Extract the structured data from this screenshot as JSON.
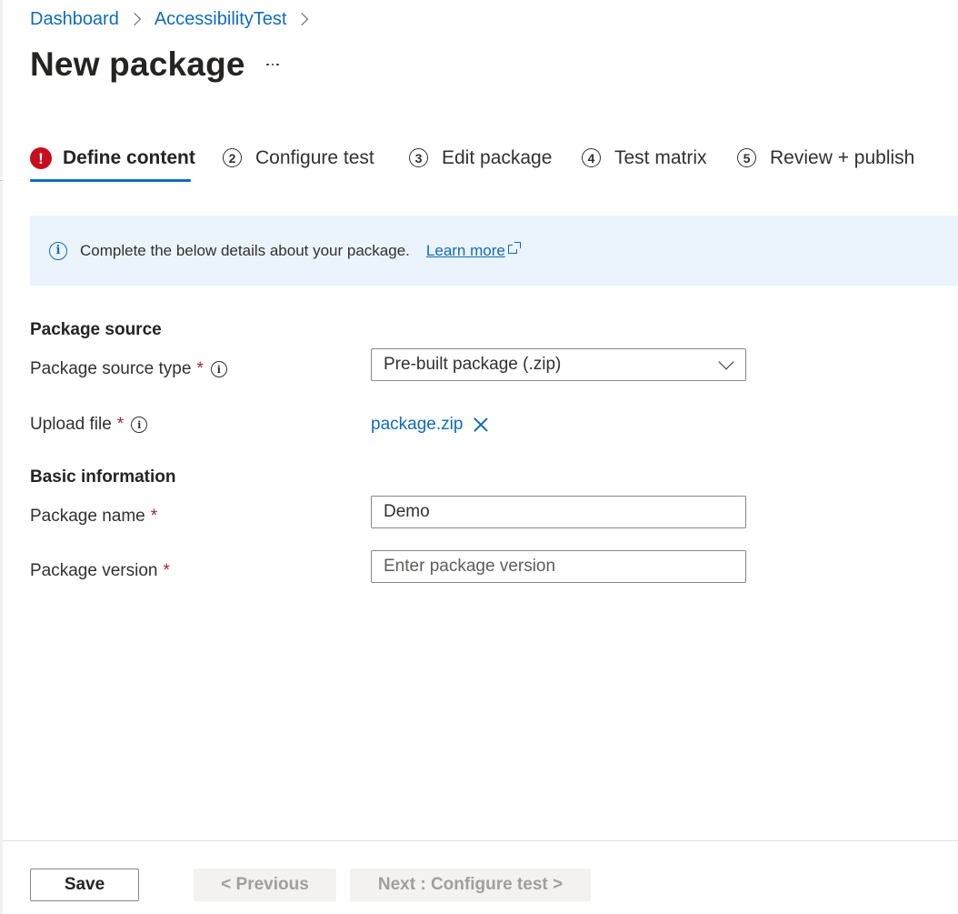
{
  "breadcrumb": {
    "items": [
      "Dashboard",
      "AccessibilityTest"
    ]
  },
  "page": {
    "title": "New package",
    "more_icon": "ellipsis-icon"
  },
  "tabs": [
    {
      "number": "!",
      "label": "Define content",
      "state": "error",
      "active": true
    },
    {
      "number": "2",
      "label": "Configure test",
      "state": "default",
      "active": false
    },
    {
      "number": "3",
      "label": "Edit package",
      "state": "default",
      "active": false
    },
    {
      "number": "4",
      "label": "Test matrix",
      "state": "default",
      "active": false
    },
    {
      "number": "5",
      "label": "Review + publish",
      "state": "default",
      "active": false
    }
  ],
  "info_bar": {
    "icon": "info-icon",
    "text": "Complete the below details about your package.",
    "link_label": "Learn more",
    "link_icon": "external-link-icon"
  },
  "form": {
    "package_source": {
      "heading": "Package source",
      "source_type_label": "Package source type",
      "source_type_value": "Pre-built package (.zip)",
      "upload_label": "Upload file",
      "uploaded_file": "package.zip"
    },
    "basic_info": {
      "heading": "Basic information",
      "name_label": "Package name",
      "name_value": "Demo",
      "version_label": "Package version",
      "version_value": "",
      "version_placeholder": "Enter package version"
    },
    "required_marker": "*",
    "help_icon": "info-icon"
  },
  "footer": {
    "save_label": "Save",
    "previous_label": "< Previous",
    "next_label": "Next : Configure test >"
  },
  "colors": {
    "accent": "#0f6cbd",
    "error": "#c50f1f",
    "required": "#a4262c",
    "info_background": "#ebf3fc",
    "disabled_background": "#f3f2f1",
    "disabled_text": "#a19f9d"
  }
}
